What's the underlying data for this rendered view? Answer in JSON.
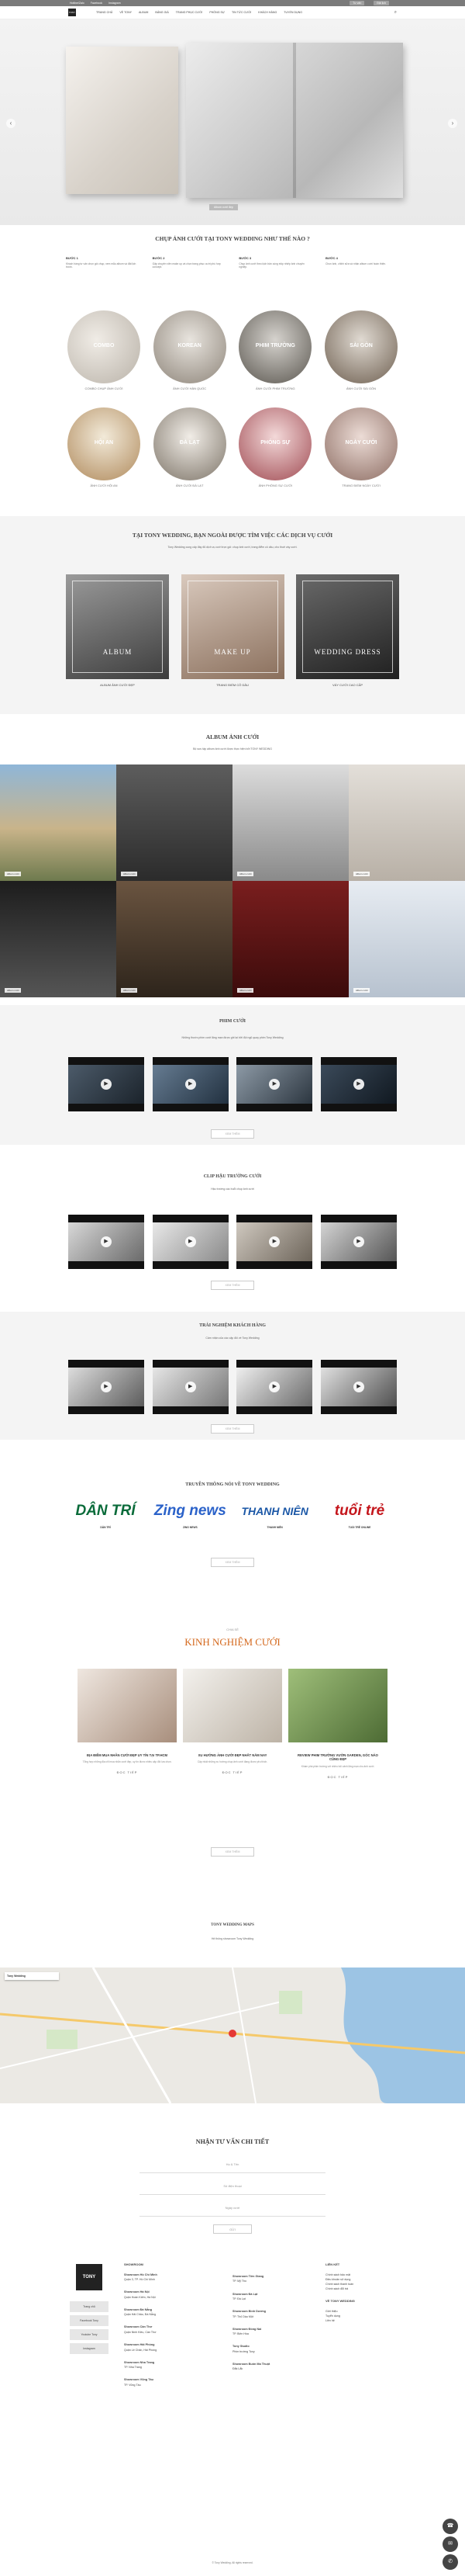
{
  "topbar": {
    "items": [
      "Hotline/Zalo",
      "Facebook",
      "Instagram",
      "Tiktok",
      "Youtube"
    ],
    "buttons": [
      "Tư vấn",
      "Đặt lịch"
    ]
  },
  "nav": {
    "logo": "TONY",
    "items": [
      "Trang chủ",
      "Về Tony",
      "Album",
      "Bảng giá",
      "Trang phục cưới",
      "Phóng sự",
      "Tin tức cưới",
      "Khách hàng",
      "Tuyển dụng"
    ]
  },
  "hero": {
    "caption": "Album cưới đẹp"
  },
  "process": {
    "title": "CHỤP ẢNH CƯỚI TẠI TONY WEDDING NHƯ THẾ NÀO ?",
    "steps": [
      {
        "label": "BƯỚC 1",
        "text": "Khách hàng tư vấn chọn gói chụp, xem mẫu album và đặt lịch trước."
      },
      {
        "label": "BƯỚC 2",
        "text": "Gặp chuyên viên make up và chọn trang phục cưới phù hợp concept."
      },
      {
        "label": "BƯỚC 3",
        "text": "Chụp ảnh cưới theo kịch bản cùng ekip nhiếp ảnh chuyên nghiệp."
      },
      {
        "label": "BƯỚC 4",
        "text": "Chọn ảnh, chỉnh sửa và nhận album cưới hoàn thiện."
      }
    ]
  },
  "concepts_row1": [
    {
      "label": "COMBO",
      "caption": "COMBO CHỤP ẢNH CƯỚI"
    },
    {
      "label": "KOREAN",
      "caption": "ẢNH CƯỚI HÀN QUỐC"
    },
    {
      "label": "PHIM TRƯỜNG",
      "caption": "ẢNH CƯỚI PHIM TRƯỜNG"
    },
    {
      "label": "SÀI GÒN",
      "caption": "ẢNH CƯỚI SÀI GÒN"
    }
  ],
  "concepts_row2": [
    {
      "label": "HỘI AN",
      "caption": "ẢNH CƯỚI HỘI AN"
    },
    {
      "label": "ĐÀ LẠT",
      "caption": "ẢNH CƯỚI ĐÀ LẠT"
    },
    {
      "label": "PHÓNG SỰ",
      "caption": "ẢNH PHÓNG SỰ CƯỚI"
    },
    {
      "label": "NGÀY CƯỚI",
      "caption": "TRANG ĐIỂM NGÀY CƯỚI"
    }
  ],
  "services": {
    "title": "TẠI TONY WEDDING, BẠN NGOÀI ĐƯỢC TÌM VIỆC CÁC DỊCH VỤ CƯỚI",
    "subtitle": "Tony Wedding cung cấp đầy đủ dịch vụ cưới trọn gói: chụp ảnh cưới, trang điểm cô dâu, cho thuê váy cưới.",
    "cards": [
      {
        "label": "ALBUM",
        "caption": "ALBUM ẢNH CƯỚI ĐẸP"
      },
      {
        "label": "MAKE UP",
        "caption": "TRANG ĐIỂM CÔ DÂU"
      },
      {
        "label": "WEDDING DRESS",
        "caption": "VÁY CƯỚI CAO CẤP"
      }
    ]
  },
  "album": {
    "title": "ALBUM ẢNH CƯỚI",
    "subtitle": "Bộ sưu tập album ảnh cưới được thực hiện bởi TONY WEDDING",
    "tags": [
      "Album cưới",
      "Album cưới",
      "Album cưới",
      "Album cưới",
      "Album cưới",
      "Album cưới",
      "Album cưới",
      "Album cưới"
    ]
  },
  "phim": {
    "title": "PHIM CƯỚI",
    "subtitle": "Những thước phim cưới lãng mạn được ghi lại bởi đội ngũ quay phim Tony Wedding",
    "button": "XEM THÊM"
  },
  "dress": {
    "title": "CLIP HẬU TRƯỜNG CƯỚI",
    "subtitle": "Hậu trường các buổi chụp ảnh cưới",
    "button": "XEM THÊM"
  },
  "feedback": {
    "title": "TRẢI NGHIỆM KHÁCH HÀNG",
    "subtitle": "Cảm nhận của các cặp đôi về Tony Wedding",
    "button": "XEM THÊM"
  },
  "press": {
    "title": "TRUYỀN THÔNG NÓI VỀ TONY WEDDING",
    "items": [
      {
        "logo": "DÂN TRÍ",
        "caption": "DÂN TRÍ",
        "color": "#0a6b3a"
      },
      {
        "logo": "Zing news",
        "caption": "ZING NEWS",
        "color": "#2b62c9"
      },
      {
        "logo": "THANH NIÊN",
        "caption": "THANH NIÊN",
        "color": "#1b57a6"
      },
      {
        "logo": "tuổi trẻ",
        "caption": "TUỔI TRẺ ONLINE",
        "color": "#c4161c"
      }
    ],
    "button": "XEM THÊM"
  },
  "experience": {
    "pre": "CHIA SẺ",
    "title": "KINH NGHIỆM CƯỚI",
    "posts": [
      {
        "title": "ĐỊA ĐIỂM MUA NHẪN CƯỚI ĐẸP UY TÍN TẠI TP.HCM",
        "text": "Tổng hợp những địa chỉ mua nhẫn cưới đẹp, uy tín được nhiều cặp đôi lựa chọn.",
        "more": "ĐỌC TIẾP"
      },
      {
        "title": "XU HƯỚNG ẢNH CƯỚI ĐẸP NHẤT NĂM NAY",
        "text": "Cập nhật những xu hướng chụp ảnh cưới đang được yêu thích.",
        "more": "ĐỌC TIẾP"
      },
      {
        "title": "REVIEW PHIM TRƯỜNG VƯỜN GARDEN, GÓC NÀO CŨNG ĐẸP",
        "text": "Khám phá phim trường với nhiều bối cảnh lãng mạn cho ảnh cưới.",
        "more": "ĐỌC TIẾP"
      }
    ],
    "button": "XEM THÊM"
  },
  "map": {
    "title": "TONY WEDDING MAPS",
    "subtitle": "Hệ thống showroom Tony Wedding",
    "place": "Tony Wedding"
  },
  "form": {
    "title": "NHẬN TƯ VẤN CHI TIẾT",
    "fields": [
      "Họ & Tên",
      "Số điện thoại",
      "Ngày cưới"
    ],
    "send": "GỬI"
  },
  "footer": {
    "side": [
      "Trang chủ",
      "Facebook Tony",
      "Youtube Tony",
      "Instagram"
    ],
    "showroom_title": "SHOWROOM",
    "showrooms_left": [
      {
        "name": "Showroom Hồ Chí Minh",
        "addr": "Quận 3, TP. Hồ Chí Minh"
      },
      {
        "name": "Showroom Hà Nội",
        "addr": "Quận Hoàn Kiếm, Hà Nội"
      },
      {
        "name": "Showroom Đà Nẵng",
        "addr": "Quận Hải Châu, Đà Nẵng"
      },
      {
        "name": "Showroom Cần Thơ",
        "addr": "Quận Ninh Kiều, Cần Thơ"
      },
      {
        "name": "Showroom Hải Phòng",
        "addr": "Quận Lê Chân, Hải Phòng"
      },
      {
        "name": "Showroom Nha Trang",
        "addr": "TP. Nha Trang"
      },
      {
        "name": "Showroom Vũng Tàu",
        "addr": "TP. Vũng Tàu"
      }
    ],
    "showrooms_mid": [
      {
        "name": "Showroom Tiền Giang",
        "addr": "TP. Mỹ Tho"
      },
      {
        "name": "Showroom Đà Lạt",
        "addr": "TP. Đà Lạt"
      },
      {
        "name": "Showroom Bình Dương",
        "addr": "TP. Thủ Dầu Một"
      },
      {
        "name": "Showroom Đồng Nai",
        "addr": "TP. Biên Hòa"
      },
      {
        "name": "Tony Studio",
        "addr": "Phim trường Tony"
      },
      {
        "name": "Showroom Buôn Ma Thuột",
        "addr": "Đắk Lắk"
      }
    ],
    "links_title": "LIÊN KẾT",
    "links": [
      "Chính sách bảo mật",
      "Điều khoản sử dụng",
      "Chính sách thanh toán",
      "Chính sách đổi trả"
    ],
    "links2_title": "VỀ TONY WEDDING",
    "links2": [
      "Giới thiệu",
      "Tuyển dụng",
      "Liên hệ"
    ],
    "copyright": "© Tony Wedding. All rights reserved."
  },
  "colors": {
    "accent": "#d4691e",
    "dark": "#222222",
    "band": "#f4f4f4"
  }
}
